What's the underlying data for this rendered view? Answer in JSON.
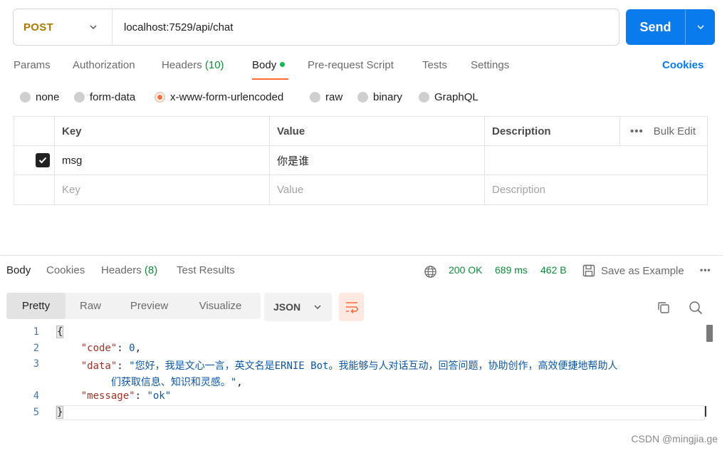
{
  "request": {
    "method": "POST",
    "url": "localhost:7529/api/chat",
    "send_label": "Send"
  },
  "request_tabs": [
    {
      "label": "Params"
    },
    {
      "label": "Authorization"
    },
    {
      "label": "Headers",
      "count": "(10)"
    },
    {
      "label": "Body"
    },
    {
      "label": "Pre-request Script"
    },
    {
      "label": "Tests"
    },
    {
      "label": "Settings"
    }
  ],
  "cookies_link": "Cookies",
  "body_types": [
    {
      "label": "none",
      "selected": false
    },
    {
      "label": "form-data",
      "selected": false
    },
    {
      "label": "x-www-form-urlencoded",
      "selected": true
    },
    {
      "label": "raw",
      "selected": false
    },
    {
      "label": "binary",
      "selected": false
    },
    {
      "label": "GraphQL",
      "selected": false
    }
  ],
  "params_table": {
    "headers": {
      "key": "Key",
      "value": "Value",
      "description": "Description"
    },
    "bulk_edit": "Bulk Edit",
    "rows": [
      {
        "checked": true,
        "key": "msg",
        "value": "你是谁",
        "description": ""
      }
    ],
    "placeholder": {
      "key": "Key",
      "value": "Value",
      "description": "Description"
    }
  },
  "response_tabs": [
    {
      "label": "Body"
    },
    {
      "label": "Cookies"
    },
    {
      "label": "Headers",
      "count": "(8)"
    },
    {
      "label": "Test Results"
    }
  ],
  "response_meta": {
    "status": "200 OK",
    "time": "689 ms",
    "size": "462 B",
    "save_label": "Save as Example"
  },
  "view_modes": [
    {
      "label": "Pretty"
    },
    {
      "label": "Raw"
    },
    {
      "label": "Preview"
    },
    {
      "label": "Visualize"
    }
  ],
  "format_label": "JSON",
  "code": {
    "line_numbers": [
      "1",
      "2",
      "3",
      "",
      "4",
      "5"
    ],
    "open_brace": "{",
    "close_brace": "}",
    "code_key": "\"code\"",
    "code_value": "0",
    "data_key": "\"data\"",
    "data_value_1": "\"您好，我是文心一言，英文名是ERNIE Bot。我能够与人对话互动，回答问题，协助创作，高效便捷地帮助人",
    "data_value_2": "们获取信息、知识和灵感。\"",
    "message_key": "\"message\"",
    "message_value": "\"ok\""
  },
  "watermark": "CSDN @mingjia.ge",
  "colors": {
    "accent": "#ff6c37",
    "send": "#097bed",
    "method": "#ad7a03",
    "success": "#0f8a3a"
  }
}
